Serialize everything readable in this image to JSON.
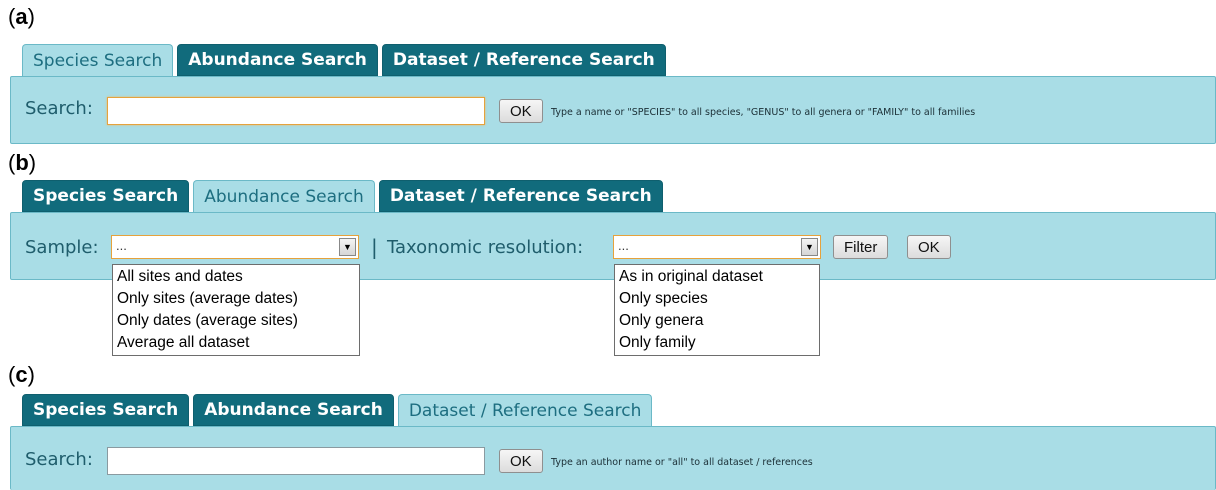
{
  "tabs": [
    "Species Search",
    "Abundance Search",
    "Dataset / Reference Search"
  ],
  "panel_a": {
    "label": "a",
    "search_label": "Search:",
    "search_value": "",
    "ok": "OK",
    "hint": "Type a name or \"SPECIES\" to all species, \"GENUS\" to all genera or \"FAMILY\" to all families"
  },
  "panel_b": {
    "label": "b",
    "sample_label": "Sample:",
    "sample_value": "...",
    "separator": "|",
    "taxo_label": "Taxonomic resolution:",
    "taxo_value": "...",
    "filter": "Filter",
    "ok": "OK",
    "sample_options": [
      "All sites and dates",
      "Only sites (average dates)",
      "Only dates (average sites)",
      "Average all dataset"
    ],
    "taxo_options": [
      "As in original dataset",
      "Only species",
      "Only genera",
      "Only family"
    ]
  },
  "panel_c": {
    "label": "c",
    "search_label": "Search:",
    "search_value": "",
    "ok": "OK",
    "hint": "Type an author name or \"all\" to all dataset / references"
  },
  "colors": {
    "panel_bg": "#a9dde6",
    "tab_inactive": "#116b7c",
    "focus_border": "#e6a23c"
  }
}
